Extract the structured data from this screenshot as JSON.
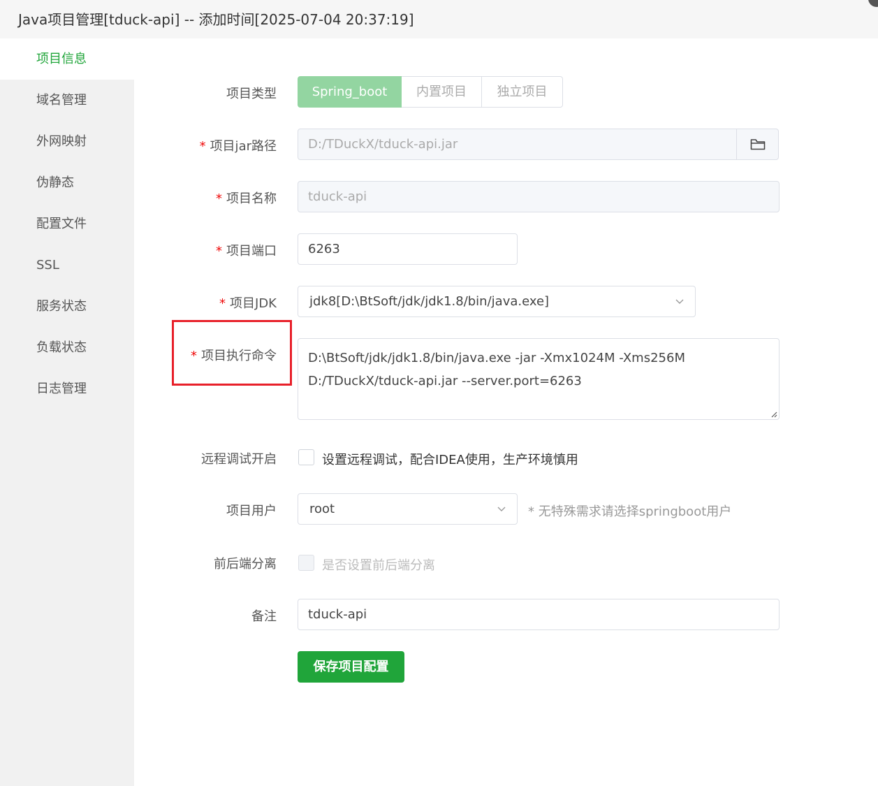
{
  "window": {
    "title": "Java项目管理[tduck-api] -- 添加时间[2025-07-04 20:37:19]"
  },
  "sidebar": {
    "items": [
      {
        "label": "项目信息",
        "active": true
      },
      {
        "label": "域名管理"
      },
      {
        "label": "外网映射"
      },
      {
        "label": "伪静态"
      },
      {
        "label": "配置文件"
      },
      {
        "label": "SSL"
      },
      {
        "label": "服务状态"
      },
      {
        "label": "负载状态"
      },
      {
        "label": "日志管理"
      }
    ]
  },
  "form": {
    "project_type": {
      "label": "项目类型",
      "options": [
        "Spring_boot",
        "内置项目",
        "独立项目"
      ],
      "selected": "Spring_boot"
    },
    "jar_path": {
      "label": "项目jar路径",
      "required": "*",
      "value": "D:/TDuckX/tduck-api.jar",
      "icon": "folder-icon"
    },
    "project_name": {
      "label": "项目名称",
      "required": "*",
      "value": "tduck-api"
    },
    "project_port": {
      "label": "项目端口",
      "required": "*",
      "value": "6263"
    },
    "project_jdk": {
      "label": "项目JDK",
      "required": "*",
      "value": "jdk8[D:\\BtSoft/jdk/jdk1.8/bin/java.exe]"
    },
    "exec_command": {
      "label": "项目执行命令",
      "required": "*",
      "line1": "D:\\BtSoft/jdk/jdk1.8/bin/java.exe -jar -Xmx1024M -Xms256M",
      "line2": "D:/TDuckX/tduck-api.jar --server.port=6263"
    },
    "remote_debug": {
      "label": "远程调试开启",
      "text": "设置远程调试，配合IDEA使用，生产环境慎用",
      "checked": false
    },
    "project_user": {
      "label": "项目用户",
      "value": "root",
      "hint": "* 无特殊需求请选择springboot用户"
    },
    "frontend_separation": {
      "label": "前后端分离",
      "text": "是否设置前后端分离",
      "checked": false,
      "disabled": true
    },
    "remark": {
      "label": "备注",
      "value": "tduck-api"
    },
    "save_label": "保存项目配置"
  },
  "colors": {
    "accent": "#20a53a",
    "highlight": "#e8202a",
    "required": "#ef0808"
  }
}
